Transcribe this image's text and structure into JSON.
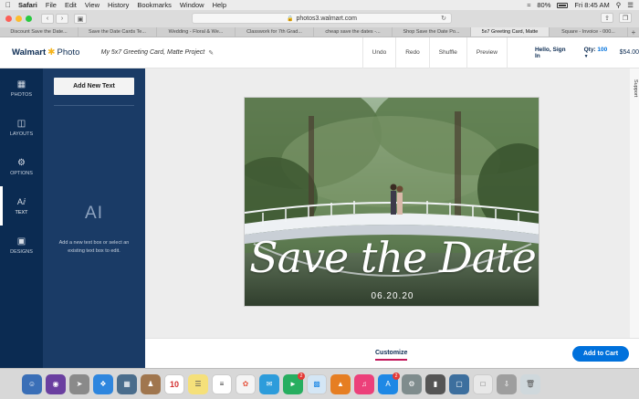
{
  "menubar": {
    "apple": "",
    "app": "Safari",
    "items": [
      "File",
      "Edit",
      "View",
      "History",
      "Bookmarks",
      "Window",
      "Help"
    ],
    "battery": "80%",
    "clock": "Fri 8:45 AM"
  },
  "browser": {
    "url": "photos3.walmart.com",
    "tabs": [
      "Discount Save the Date...",
      "Save the Date Cards Te...",
      "Wedding - Floral & We...",
      "Classwork for 7th Grad...",
      "cheap save the dates -...",
      "Shop Save the Date Po...",
      "5x7 Greeting Card, Matte",
      "Square - Invoice - 000..."
    ],
    "active_tab": 6
  },
  "header": {
    "brand_name": "Walmart",
    "brand_sub": "Photo",
    "project_name": "My 5x7 Greeting Card, Matte Project",
    "actions": [
      "Undo",
      "Redo",
      "Shuffle",
      "Preview"
    ],
    "signin": "Hello, Sign In",
    "qty_label": "Qty:",
    "qty_value": "100",
    "price": "$54.00"
  },
  "sidebar": {
    "items": [
      {
        "label": "PHOTOS",
        "icon": "photos-icon"
      },
      {
        "label": "LAYOUTS",
        "icon": "layouts-icon"
      },
      {
        "label": "OPTIONS",
        "icon": "gear-icon"
      },
      {
        "label": "TEXT",
        "icon": "text-icon"
      },
      {
        "label": "DESIGNS",
        "icon": "designs-icon"
      }
    ],
    "active": "TEXT"
  },
  "panel": {
    "add_text_label": "Add New Text",
    "placeholder_glyph": "AI",
    "hint": "Add a new text box or select an existing text box to edit."
  },
  "card": {
    "headline": "Save the Date",
    "date": "06.20.20"
  },
  "support_label": "Support",
  "bottom": {
    "customize": "Customize",
    "add_to_cart": "Add to Cart"
  },
  "dock": {
    "calendar_day": "10",
    "messages_badge": "2",
    "appstore_badge": "2"
  },
  "colors": {
    "navy": "#0b2b52",
    "panel": "#1a3b66",
    "accent_blue": "#0071dc",
    "underline": "#c2185b"
  }
}
